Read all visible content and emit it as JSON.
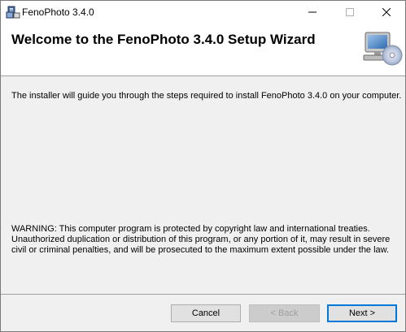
{
  "window": {
    "title": "FenoPhoto 3.4.0",
    "icon": "installer-icon"
  },
  "titlebar_buttons": {
    "minimize": "minimize-icon",
    "maximize": "maximize-icon",
    "close": "close-icon"
  },
  "banner": {
    "title": "Welcome to the FenoPhoto 3.4.0 Setup Wizard",
    "icon": "computer-cd-icon"
  },
  "body": {
    "intro": "The installer will guide you through the steps required to install FenoPhoto 3.4.0 on your computer.",
    "warning": "WARNING: This computer program is protected by copyright law and international treaties. Unauthorized duplication or distribution of this program, or any portion of it, may result in severe civil or criminal penalties, and will be prosecuted to the maximum extent possible under the law."
  },
  "buttons": {
    "cancel": "Cancel",
    "back": "< Back",
    "back_enabled": false,
    "next": "Next >"
  },
  "colors": {
    "focus_border": "#0078d7",
    "dialog_bg": "#f0f0f0"
  }
}
